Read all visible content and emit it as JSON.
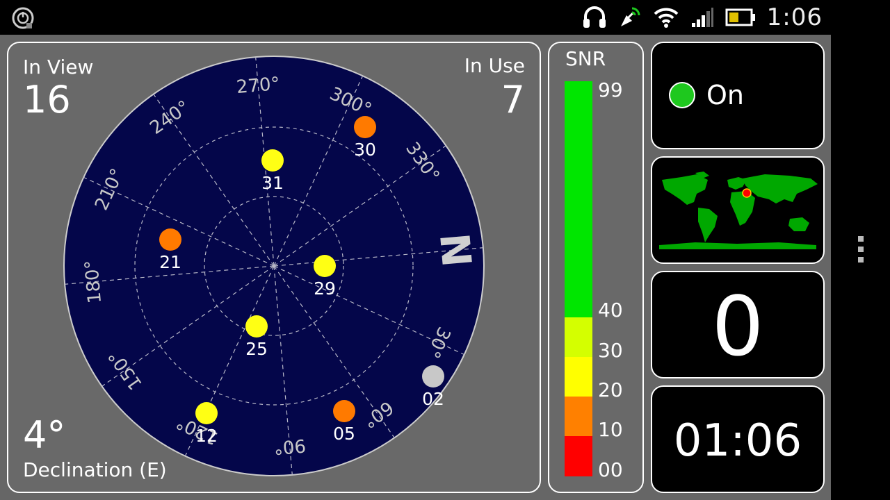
{
  "status_bar": {
    "time": "1:06",
    "icons": [
      "power-app-icon",
      "headset-icon",
      "gps-satellite-icon",
      "wifi-icon",
      "signal-icon",
      "battery-icon"
    ]
  },
  "sky": {
    "in_view_label": "In View",
    "in_view_value": "16",
    "in_use_label": "In Use",
    "in_use_value": "7",
    "declination_value": "4°",
    "declination_label": "Declination (E)",
    "north_label": "N",
    "bearing_labels": [
      "30°",
      "60°",
      "90°",
      "120°",
      "150°",
      "180°",
      "210°",
      "240°",
      "270°",
      "300°",
      "330°"
    ],
    "colors": {
      "background": "#04064a",
      "grid": "#b8b8c8"
    },
    "satellites": [
      {
        "id": "30",
        "color": "#ff7a00"
      },
      {
        "id": "31",
        "color": "#ffff14"
      },
      {
        "id": "21",
        "color": "#ff7a00"
      },
      {
        "id": "29",
        "color": "#ffff14"
      },
      {
        "id": "25",
        "color": "#ffff14"
      },
      {
        "id": "02",
        "color": "#c8c8c8"
      },
      {
        "id": "05",
        "color": "#ff7a00"
      },
      {
        "id": "12",
        "color": "#ffff14"
      }
    ]
  },
  "snr": {
    "title": "SNR",
    "ticks": [
      "99",
      "40",
      "30",
      "20",
      "10",
      "00"
    ],
    "bands": [
      {
        "from": 40,
        "to": 99,
        "color": "#00e600"
      },
      {
        "from": 30,
        "to": 40,
        "color": "#d4ff00"
      },
      {
        "from": 20,
        "to": 30,
        "color": "#ffff00"
      },
      {
        "from": 10,
        "to": 20,
        "color": "#ff8000"
      },
      {
        "from": 0,
        "to": 10,
        "color": "#ff0000"
      }
    ]
  },
  "fix": {
    "status": "On",
    "indicator_color": "#1ec81e"
  },
  "map": {
    "land_color": "#00a800",
    "marker_color": "#ff0000"
  },
  "counter": "0",
  "clock": "01:06"
}
